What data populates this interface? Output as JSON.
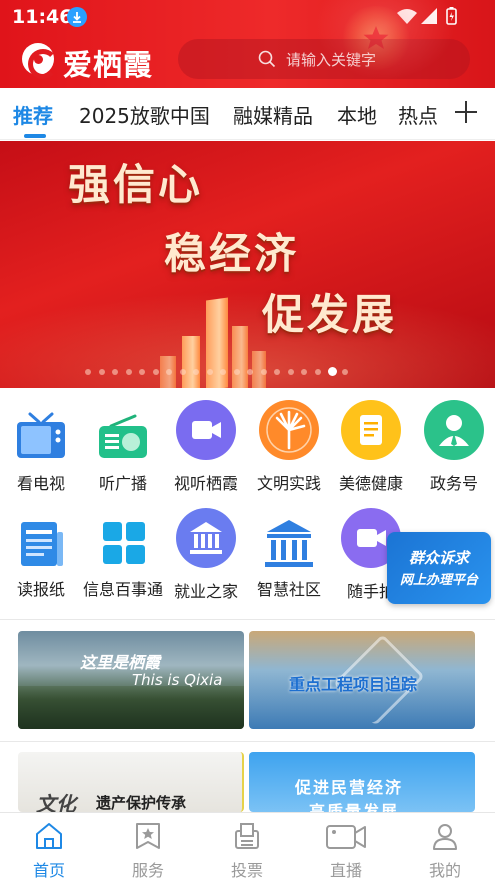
{
  "status_bar": {
    "time": "11:46"
  },
  "header": {
    "app_name": "爱栖霞",
    "search_placeholder": "请输入关键字"
  },
  "tabs": [
    {
      "label": "推荐",
      "active": true
    },
    {
      "label": "2025放歌中国",
      "active": false
    },
    {
      "label": "融媒精品",
      "active": false
    },
    {
      "label": "本地",
      "active": false
    },
    {
      "label": "热点",
      "active": false
    }
  ],
  "banner": {
    "lines": [
      "强信心",
      "稳经济",
      "促发展"
    ],
    "slide_count": 20,
    "active_slide": 18
  },
  "services": [
    {
      "label": "看电视",
      "icon": "tv-icon"
    },
    {
      "label": "听广播",
      "icon": "radio-icon"
    },
    {
      "label": "视听栖霞",
      "icon": "video-icon"
    },
    {
      "label": "文明实践",
      "icon": "palm-icon"
    },
    {
      "label": "美德健康",
      "icon": "document-icon"
    },
    {
      "label": "政务号",
      "icon": "person-icon"
    },
    {
      "label": "读报纸",
      "icon": "newspaper-icon"
    },
    {
      "label": "信息百事通",
      "icon": "grid-icon"
    },
    {
      "label": "就业之家",
      "icon": "bank-icon"
    },
    {
      "label": "智慧社区",
      "icon": "building-icon"
    },
    {
      "label": "随手拍",
      "icon": "camera-icon"
    }
  ],
  "float_card": {
    "line1": "群众诉求",
    "line2": "网上办理平台"
  },
  "cards": [
    {
      "caption_main": "这里是栖霞",
      "caption_sub": "This is Qixia"
    },
    {
      "caption_main": "重点工程项目追踪"
    },
    {
      "caption_main": "遗产保护传承",
      "caption_prefix": "文化"
    },
    {
      "caption_main": "促进民营经济",
      "caption_sub": "高质量发展"
    }
  ],
  "bottom_nav": [
    {
      "label": "首页",
      "icon": "home-icon",
      "active": true
    },
    {
      "label": "服务",
      "icon": "service-icon",
      "active": false
    },
    {
      "label": "投票",
      "icon": "vote-icon",
      "active": false
    },
    {
      "label": "直播",
      "icon": "live-icon",
      "active": false
    },
    {
      "label": "我的",
      "icon": "profile-icon",
      "active": false
    }
  ],
  "colors": {
    "brand_red": "#e11b20",
    "accent_blue": "#1e88e5"
  }
}
